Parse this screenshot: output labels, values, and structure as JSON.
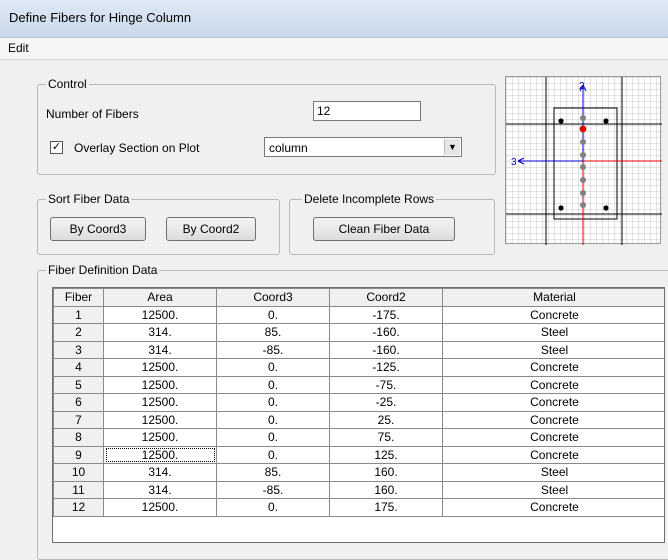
{
  "window": {
    "title": "Define Fibers for Hinge Column"
  },
  "menu": {
    "items": [
      {
        "label": "Edit"
      }
    ]
  },
  "control": {
    "legend": "Control",
    "num_fibers_label": "Number of Fibers",
    "num_fibers_value": "12",
    "overlay_label": "Overlay Section on Plot",
    "overlay_checked": true,
    "overlay_check_glyph": "✓",
    "section_selected": "column"
  },
  "sort": {
    "legend": "Sort Fiber Data",
    "by_coord3_label": "By Coord3",
    "by_coord2_label": "By Coord2"
  },
  "delete_rows": {
    "legend": "Delete Incomplete Rows",
    "clean_label": "Clean Fiber Data"
  },
  "preview": {
    "axis2_label": "2",
    "axis3_label": "3",
    "axis_color": "#0000cc",
    "red_color": "#e00000"
  },
  "fiber_table": {
    "legend": "Fiber Definition Data",
    "columns": [
      "Fiber",
      "Area",
      "Coord3",
      "Coord2",
      "Material"
    ],
    "rows": [
      [
        "1",
        "12500.",
        "0.",
        "-175.",
        "Concrete"
      ],
      [
        "2",
        "314.",
        "85.",
        "-160.",
        "Steel"
      ],
      [
        "3",
        "314.",
        "-85.",
        "-160.",
        "Steel"
      ],
      [
        "4",
        "12500.",
        "0.",
        "-125.",
        "Concrete"
      ],
      [
        "5",
        "12500.",
        "0.",
        "-75.",
        "Concrete"
      ],
      [
        "6",
        "12500.",
        "0.",
        "-25.",
        "Concrete"
      ],
      [
        "7",
        "12500.",
        "0.",
        "25.",
        "Concrete"
      ],
      [
        "8",
        "12500.",
        "0.",
        "75.",
        "Concrete"
      ],
      [
        "9",
        "12500.",
        "0.",
        "125.",
        "Concrete"
      ],
      [
        "10",
        "314.",
        "85.",
        "160.",
        "Steel"
      ],
      [
        "11",
        "314.",
        "-85.",
        "160.",
        "Steel"
      ],
      [
        "12",
        "12500.",
        "0.",
        "175.",
        "Concrete"
      ]
    ]
  }
}
